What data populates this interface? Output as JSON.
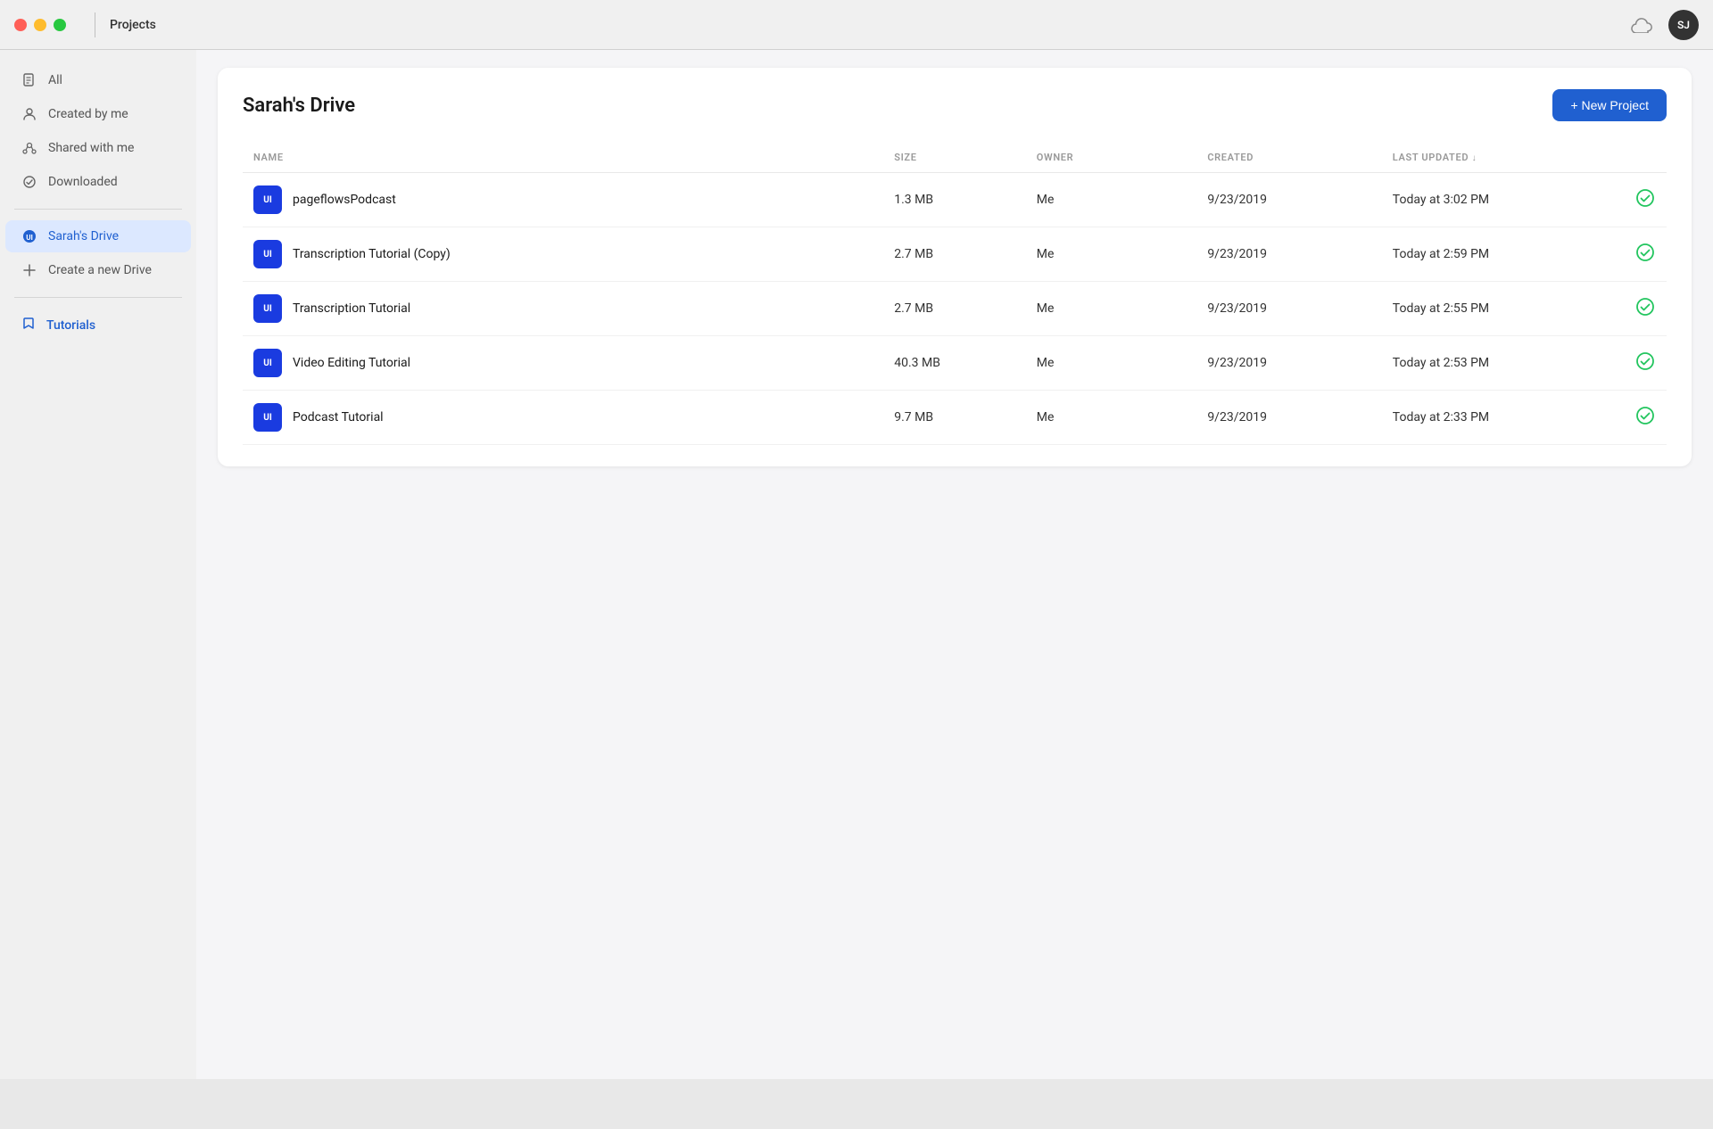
{
  "titlebar": {
    "title": "Projects",
    "avatar_initials": "SJ",
    "window_controls": {
      "close_label": "",
      "min_label": "",
      "max_label": ""
    }
  },
  "sidebar": {
    "items": [
      {
        "id": "all",
        "label": "All",
        "icon": "document-icon",
        "active": false
      },
      {
        "id": "created-by-me",
        "label": "Created by me",
        "icon": "person-icon",
        "active": false
      },
      {
        "id": "shared-with-me",
        "label": "Shared with me",
        "icon": "share-icon",
        "active": false
      },
      {
        "id": "downloaded",
        "label": "Downloaded",
        "icon": "check-circle-icon",
        "active": false
      }
    ],
    "drives": [
      {
        "id": "sarahs-drive",
        "label": "Sarah's Drive",
        "active": true
      }
    ],
    "create_drive_label": "Create a new Drive",
    "tutorials_label": "Tutorials"
  },
  "main": {
    "drive_title": "Sarah's Drive",
    "new_project_label": "+ New Project",
    "table": {
      "columns": [
        {
          "id": "name",
          "label": "NAME",
          "sortable": false
        },
        {
          "id": "size",
          "label": "SIZE",
          "sortable": false
        },
        {
          "id": "owner",
          "label": "OWNER",
          "sortable": false
        },
        {
          "id": "created",
          "label": "CREATED",
          "sortable": false
        },
        {
          "id": "last_updated",
          "label": "LAST UPDATED",
          "sortable": true
        },
        {
          "id": "status",
          "label": "",
          "sortable": false
        }
      ],
      "rows": [
        {
          "name": "pageflowsPodcast",
          "icon": "ui",
          "size": "1.3 MB",
          "owner": "Me",
          "created": "9/23/2019",
          "last_updated": "Today at 3:02 PM",
          "status": "synced"
        },
        {
          "name": "Transcription Tutorial (Copy)",
          "icon": "ui",
          "size": "2.7 MB",
          "owner": "Me",
          "created": "9/23/2019",
          "last_updated": "Today at 2:59 PM",
          "status": "synced"
        },
        {
          "name": "Transcription Tutorial",
          "icon": "ui",
          "size": "2.7 MB",
          "owner": "Me",
          "created": "9/23/2019",
          "last_updated": "Today at 2:55 PM",
          "status": "synced"
        },
        {
          "name": "Video Editing Tutorial",
          "icon": "ui",
          "size": "40.3 MB",
          "owner": "Me",
          "created": "9/23/2019",
          "last_updated": "Today at 2:53 PM",
          "status": "synced"
        },
        {
          "name": "Podcast Tutorial",
          "icon": "ui",
          "size": "9.7 MB",
          "owner": "Me",
          "created": "9/23/2019",
          "last_updated": "Today at 2:33 PM",
          "status": "synced"
        }
      ]
    }
  }
}
